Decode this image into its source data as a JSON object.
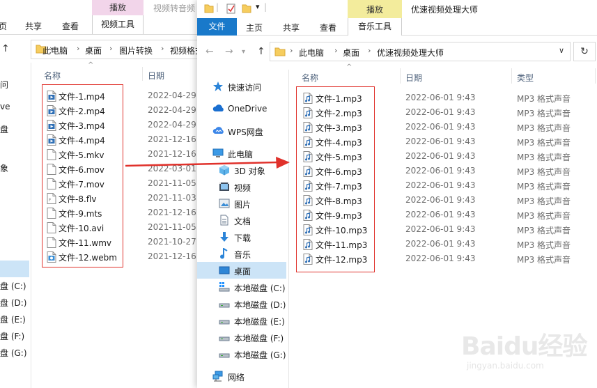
{
  "back_window": {
    "context_tab_top": "播放",
    "title": "视频转音频",
    "tabs": [
      "页",
      "共享",
      "查看"
    ],
    "context_tab": "视频工具",
    "breadcrumb": [
      "此电脑",
      "桌面",
      "图片转换",
      "视频格式"
    ],
    "sidebar_strip": [
      "问",
      "ve",
      "盘",
      "象",
      "盘 (C:)",
      "盘 (D:)",
      "盘 (E:)",
      "盘 (F:)",
      "盘 (G:)"
    ],
    "columns": {
      "name": "名称",
      "date": "日期"
    },
    "files": [
      {
        "name": "文件-1.mp4",
        "date": "2022-04-29",
        "icon": "video-file-icon"
      },
      {
        "name": "文件-2.mp4",
        "date": "2022-04-29",
        "icon": "video-file-icon"
      },
      {
        "name": "文件-3.mp4",
        "date": "2022-04-29",
        "icon": "video-file-icon"
      },
      {
        "name": "文件-4.mp4",
        "date": "2021-12-16",
        "icon": "video-file-icon"
      },
      {
        "name": "文件-5.mkv",
        "date": "2021-12-16",
        "icon": "blank-file-icon"
      },
      {
        "name": "文件-6.mov",
        "date": "2022-03-01",
        "icon": "blank-file-icon"
      },
      {
        "name": "文件-7.mov",
        "date": "2021-11-05",
        "icon": "blank-file-icon"
      },
      {
        "name": "文件-8.flv",
        "date": "2021-11-03",
        "icon": "flv-file-icon"
      },
      {
        "name": "文件-9.mts",
        "date": "2021-12-16",
        "icon": "blank-file-icon"
      },
      {
        "name": "文件-10.avi",
        "date": "2021-11-05",
        "icon": "blank-file-icon"
      },
      {
        "name": "文件-11.wmv",
        "date": "2021-10-27",
        "icon": "blank-file-icon"
      },
      {
        "name": "文件-12.webm",
        "date": "2021-12-16",
        "icon": "webm-file-icon"
      }
    ]
  },
  "front_window": {
    "context_tab_top": "播放",
    "title": "优速视频处理大师",
    "tabs": {
      "file": "文件",
      "home": "主页",
      "share": "共享",
      "view": "查看",
      "context": "音乐工具"
    },
    "breadcrumb": [
      "此电脑",
      "桌面",
      "优速视频处理大师"
    ],
    "nav": [
      {
        "label": "快速访问",
        "icon": "star-icon"
      },
      {
        "label": "OneDrive",
        "icon": "cloud-icon"
      },
      {
        "label": "WPS网盘",
        "icon": "wps-cloud-icon"
      },
      {
        "label": "此电脑",
        "icon": "computer-icon"
      },
      {
        "label": "3D 对象",
        "icon": "3d-objects-icon"
      },
      {
        "label": "视频",
        "icon": "video-folder-icon"
      },
      {
        "label": "图片",
        "icon": "pictures-folder-icon"
      },
      {
        "label": "文档",
        "icon": "documents-folder-icon"
      },
      {
        "label": "下载",
        "icon": "download-icon"
      },
      {
        "label": "音乐",
        "icon": "music-icon"
      },
      {
        "label": "桌面",
        "icon": "desktop-icon"
      },
      {
        "label": "本地磁盘 (C:)",
        "icon": "system-drive-icon"
      },
      {
        "label": "本地磁盘 (D:)",
        "icon": "drive-icon"
      },
      {
        "label": "本地磁盘 (E:)",
        "icon": "drive-icon"
      },
      {
        "label": "本地磁盘 (F:)",
        "icon": "drive-icon"
      },
      {
        "label": "本地磁盘 (G:)",
        "icon": "drive-icon"
      },
      {
        "label": "网络",
        "icon": "network-icon"
      }
    ],
    "selected_nav": "桌面",
    "columns": {
      "name": "名称",
      "date": "日期",
      "type": "类型"
    },
    "files": [
      {
        "name": "文件-1.mp3",
        "date": "2022-06-01 9:43",
        "type": "MP3 格式声音"
      },
      {
        "name": "文件-2.mp3",
        "date": "2022-06-01 9:43",
        "type": "MP3 格式声音"
      },
      {
        "name": "文件-3.mp3",
        "date": "2022-06-01 9:43",
        "type": "MP3 格式声音"
      },
      {
        "name": "文件-4.mp3",
        "date": "2022-06-01 9:43",
        "type": "MP3 格式声音"
      },
      {
        "name": "文件-5.mp3",
        "date": "2022-06-01 9:43",
        "type": "MP3 格式声音"
      },
      {
        "name": "文件-6.mp3",
        "date": "2022-06-01 9:43",
        "type": "MP3 格式声音"
      },
      {
        "name": "文件-7.mp3",
        "date": "2022-06-01 9:43",
        "type": "MP3 格式声音"
      },
      {
        "name": "文件-8.mp3",
        "date": "2022-06-01 9:43",
        "type": "MP3 格式声音"
      },
      {
        "name": "文件-9.mp3",
        "date": "2022-06-01 9:43",
        "type": "MP3 格式声音"
      },
      {
        "name": "文件-10.mp3",
        "date": "2022-06-01 9:43",
        "type": "MP3 格式声音"
      },
      {
        "name": "文件-11.mp3",
        "date": "2022-06-01 9:43",
        "type": "MP3 格式声音"
      },
      {
        "name": "文件-12.mp3",
        "date": "2022-06-01 9:43",
        "type": "MP3 格式声音"
      }
    ]
  },
  "watermark": {
    "main": "Baidu经验",
    "sub": "jingyan.baidu.com"
  },
  "colors": {
    "accent": "#1979ca",
    "selection": "#cce4f7",
    "annotation": "#e0312b",
    "video_tab": "#f2d5ea",
    "music_tab": "#f3ec9c"
  }
}
